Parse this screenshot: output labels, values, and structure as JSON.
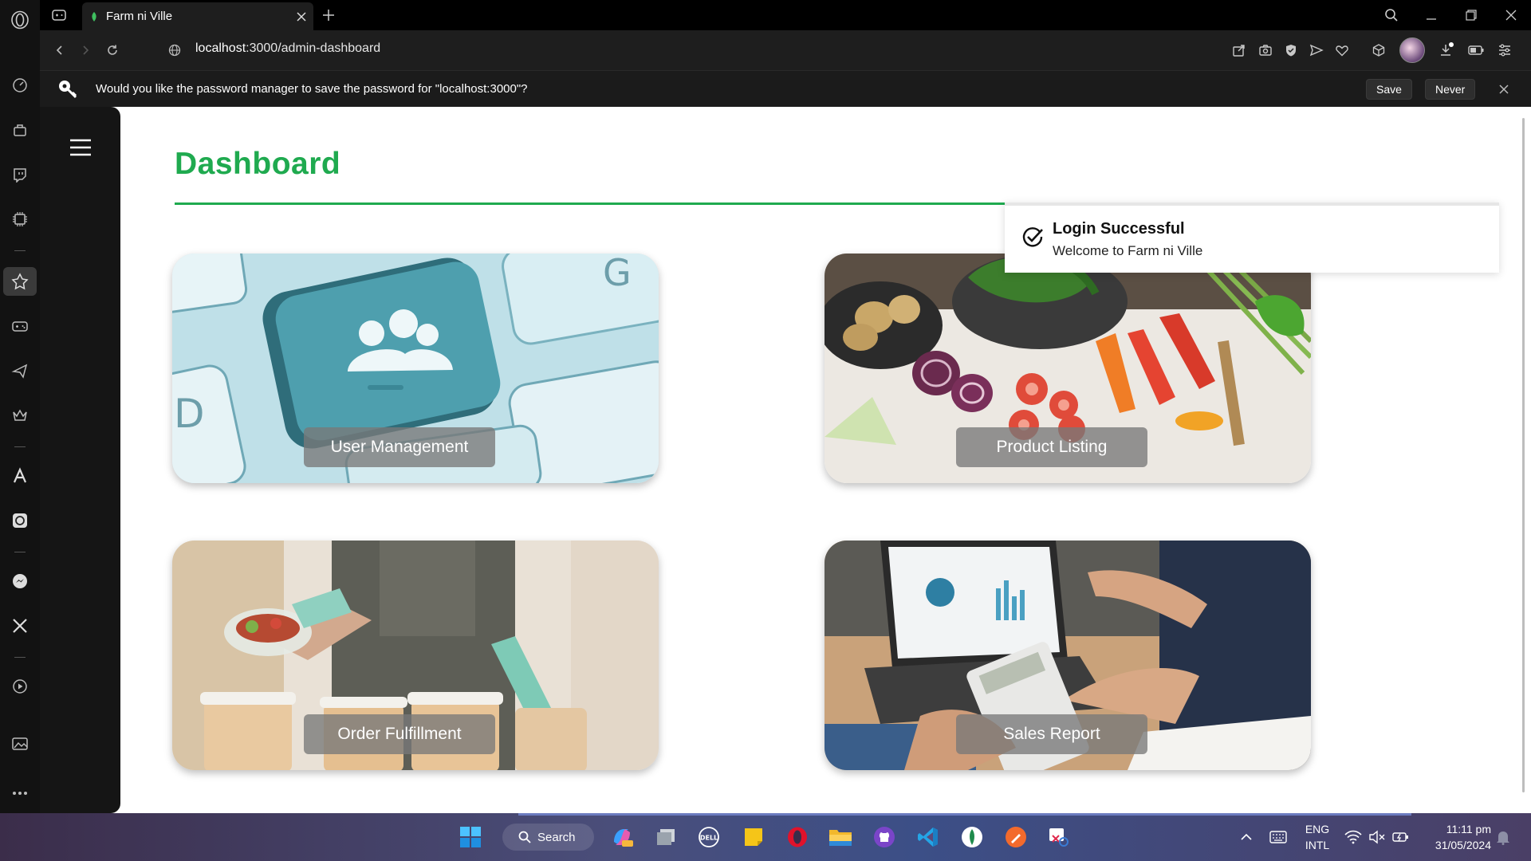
{
  "browser": {
    "tab_title": "Farm ni Ville",
    "url_host": "localhost",
    "url_rest": ":3000/admin-dashboard"
  },
  "password_prompt": {
    "message": "Would you like the password manager to save the password for \"localhost:3000\"?",
    "save_label": "Save",
    "never_label": "Never"
  },
  "page": {
    "title": "Dashboard",
    "cards": [
      {
        "label": "User Management"
      },
      {
        "label": "Product Listing"
      },
      {
        "label": "Order Fulfillment"
      },
      {
        "label": "Sales Report"
      }
    ],
    "toast": {
      "title": "Login Successful",
      "message": "Welcome to Farm ni Ville"
    }
  },
  "taskbar": {
    "search_label": "Search",
    "language_top": "ENG",
    "language_bottom": "INTL",
    "time": "11:11 pm",
    "date": "31/05/2024"
  },
  "colors": {
    "accent_green": "#1faa4f",
    "sidebar_dark": "#151515"
  }
}
